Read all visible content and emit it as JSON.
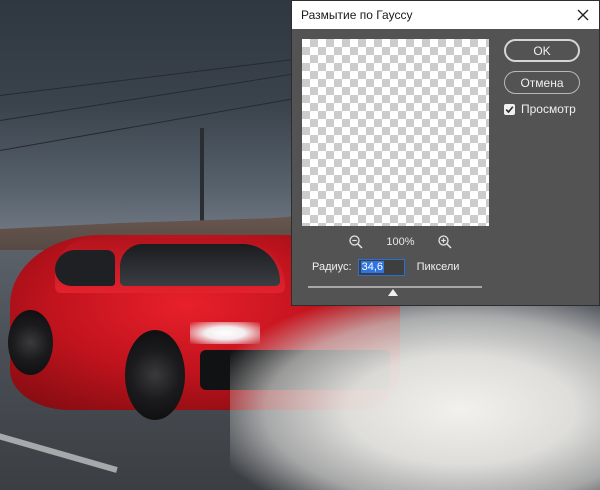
{
  "dialog": {
    "title": "Размытие по Гауссу",
    "ok_label": "OK",
    "cancel_label": "Отмена",
    "preview_label": "Просмотр",
    "preview_checked": true,
    "zoom_level": "100%",
    "radius_label": "Радиус:",
    "radius_value": "34,6",
    "radius_unit": "Пиксели",
    "icons": {
      "close": "close-icon",
      "zoom_out": "zoom-out-icon",
      "zoom_in": "zoom-in-icon",
      "check": "checkmark-icon"
    }
  }
}
